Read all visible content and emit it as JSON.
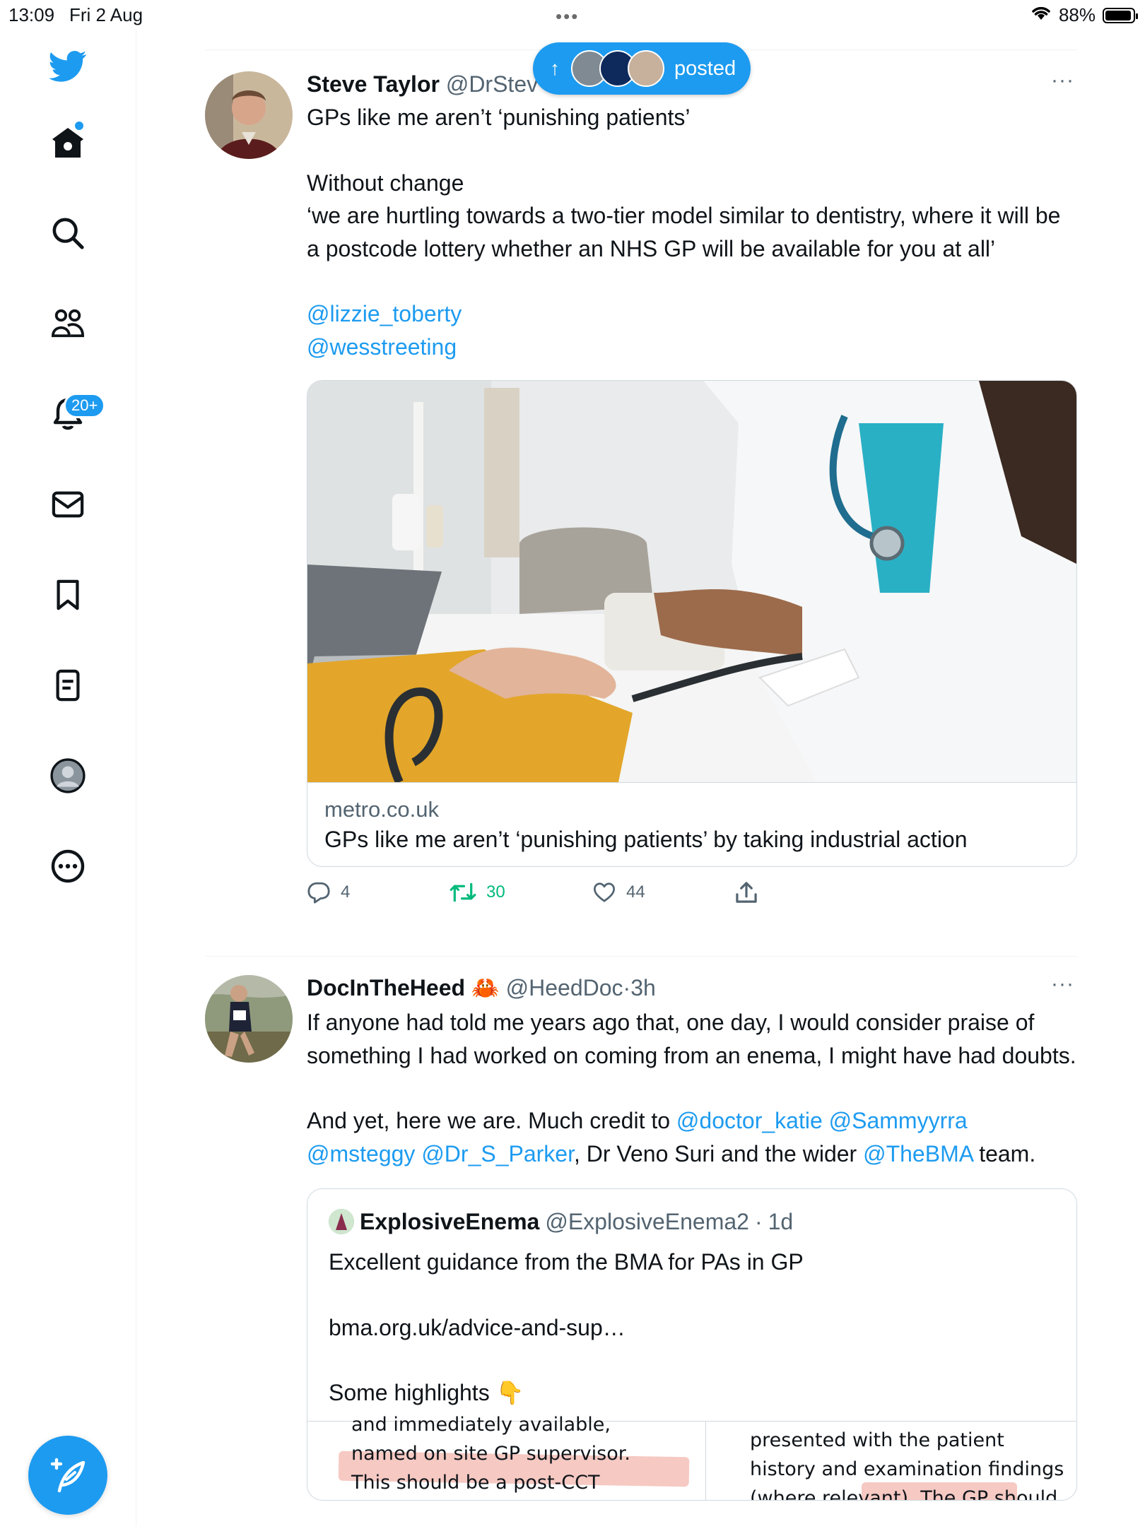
{
  "status_bar": {
    "time": "13:09",
    "date": "Fri 2 Aug",
    "dots": "•••",
    "battery": "88%"
  },
  "sidebar": {
    "notifications_badge": "20+"
  },
  "new_posts_pill": {
    "arrow": "↑",
    "label": "posted"
  },
  "tweet1": {
    "name": "Steve Taylor",
    "handle": "@DrStev",
    "more": "···",
    "lines": {
      "l1": "GPs like me aren’t ‘punishing patients’",
      "l2": "Without change",
      "l3": "‘we are hurtling towards a two-tier model similar to dentistry, where it will be a postcode lottery whether an NHS GP will be available for you at all’",
      "m1": "@lizzie_toberty",
      "m2": "@wesstreeting"
    },
    "card": {
      "domain": "metro.co.uk",
      "title": "GPs like me aren’t ‘punishing patients’ by taking industrial action"
    },
    "stats": {
      "replies": "4",
      "retweets": "30",
      "likes": "44"
    }
  },
  "tweet2": {
    "name": "DocInTheHeed",
    "emoji": "🦀",
    "handle": "@HeedDoc",
    "sep": "·",
    "time": "3h",
    "more": "···",
    "p1": "If anyone had told me years ago that, one day, I would consider praise of something I had worked on coming from an enema, I might have had doubts.",
    "p2a": "And yet, here we are. Much credit to ",
    "m_katie": "@doctor_katie",
    "m_sammy": "@Sammyyrra",
    "m_steggy": "@msteggy",
    "m_parker": "@Dr_S_Parker",
    "p2b": ", Dr Veno Suri and the wider ",
    "m_bma": "@TheBMA",
    "p2c": " team.",
    "quote": {
      "name": "ExplosiveEnema",
      "handle": "@ExplosiveEnema2",
      "sep": "·",
      "time": "1d",
      "q1": "Excellent guidance from the BMA for PAs in GP",
      "q2": "bma.org.uk/advice-and-sup…",
      "q3": "Some highlights",
      "q3_emoji": "👇",
      "img_left": [
        "and immediately available,",
        "named on site GP supervisor.",
        "This should be a post-CCT"
      ],
      "img_right": [
        "presented with the patient",
        "history and examination findings",
        "(where relevant). The GP should"
      ]
    }
  }
}
